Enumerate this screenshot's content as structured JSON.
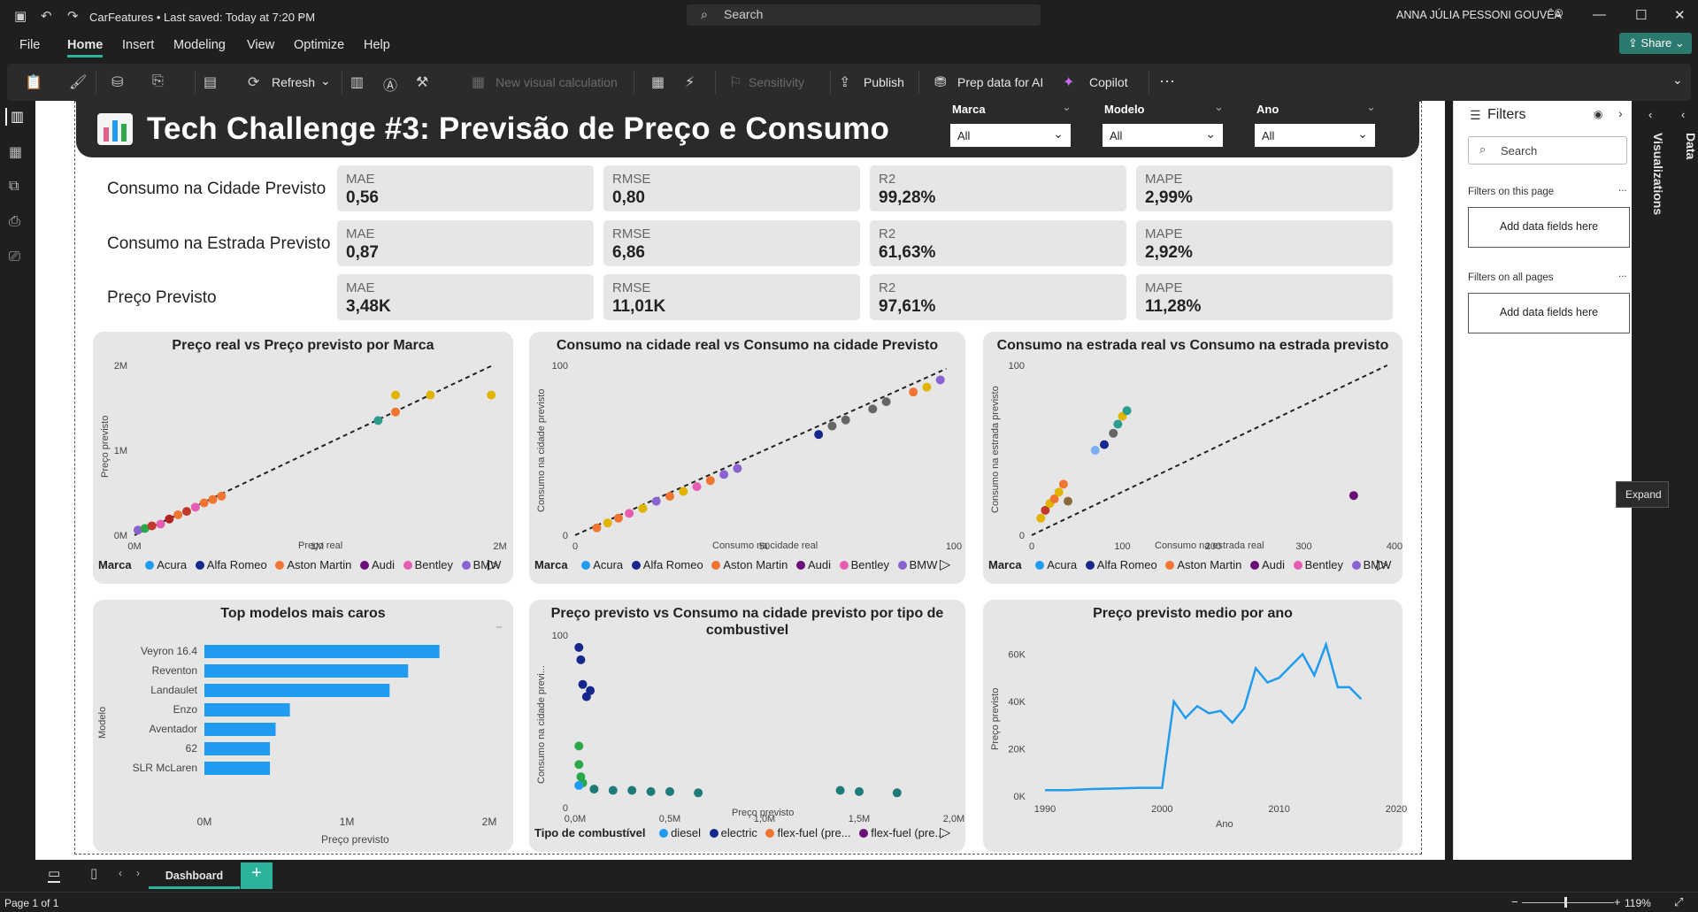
{
  "window": {
    "doc_title": "CarFeatures • Last saved: Today at 7:20 PM",
    "search_placeholder": "Search",
    "user_name": "ANNA JÚLIA PESSONI GOUVÊA"
  },
  "menu": [
    "File",
    "Home",
    "Insert",
    "Modeling",
    "View",
    "Optimize",
    "Help"
  ],
  "share_label": "Share",
  "ribbon": {
    "refresh": "Refresh",
    "new_visual_calc": "New visual calculation",
    "sensitivity": "Sensitivity",
    "publish": "Publish",
    "prep_data": "Prep data for AI",
    "copilot": "Copilot",
    "more": "···"
  },
  "report": {
    "title": "Tech Challenge #3: Previsão de Preço e Consumo",
    "slicers": [
      {
        "label": "Marca",
        "value": "All"
      },
      {
        "label": "Modelo",
        "value": "All"
      },
      {
        "label": "Ano",
        "value": "All"
      }
    ],
    "metric_rows": [
      {
        "label": "Consumo na Cidade Previsto",
        "cards": [
          {
            "k": "MAE",
            "v": "0,56"
          },
          {
            "k": "RMSE",
            "v": "0,80"
          },
          {
            "k": "R2",
            "v": "99,28%"
          },
          {
            "k": "MAPE",
            "v": "2,99%"
          }
        ]
      },
      {
        "label": "Consumo na Estrada Previsto",
        "cards": [
          {
            "k": "MAE",
            "v": "0,87"
          },
          {
            "k": "RMSE",
            "v": "6,86"
          },
          {
            "k": "R2",
            "v": "61,63%"
          },
          {
            "k": "MAPE",
            "v": "2,92%"
          }
        ]
      },
      {
        "label": "Preço Previsto",
        "cards": [
          {
            "k": "MAE",
            "v": "3,48K"
          },
          {
            "k": "RMSE",
            "v": "11,01K"
          },
          {
            "k": "R2",
            "v": "97,61%"
          },
          {
            "k": "MAPE",
            "v": "11,28%"
          }
        ]
      }
    ],
    "brand_legend": {
      "title": "Marca",
      "items": [
        {
          "name": "Acura",
          "color": "#1f9bf0"
        },
        {
          "name": "Alfa Romeo",
          "color": "#15288c"
        },
        {
          "name": "Aston Martin",
          "color": "#f07530"
        },
        {
          "name": "Audi",
          "color": "#6a0f7a"
        },
        {
          "name": "Bentley",
          "color": "#e65cb2"
        },
        {
          "name": "BMW",
          "color": "#8a63d2"
        }
      ]
    },
    "fuel_legend": {
      "title": "Tipo de combustível",
      "items": [
        {
          "name": "diesel",
          "color": "#1f9bf0"
        },
        {
          "name": "electric",
          "color": "#15288c"
        },
        {
          "name": "flex-fuel (pre...",
          "color": "#f07530"
        },
        {
          "name": "flex-fuel (pre...",
          "color": "#6a0f7a"
        }
      ]
    }
  },
  "chart_data": [
    {
      "type": "scatter",
      "title": "Preço real vs Preço previsto por Marca",
      "xlabel": "Preço real",
      "ylabel": "Preço previsto",
      "xticks": [
        "0M",
        "1M",
        "2M"
      ],
      "yticks": [
        "0M",
        "1M",
        "2M"
      ],
      "xlim": [
        0,
        2100000
      ],
      "ylim": [
        0,
        2000000
      ],
      "trendline": true,
      "points": [
        [
          20000,
          60000,
          "#8a63d2"
        ],
        [
          60000,
          80000,
          "#2aa84a"
        ],
        [
          100000,
          110000,
          "#c0392b"
        ],
        [
          150000,
          130000,
          "#e65cb2"
        ],
        [
          200000,
          190000,
          "#b22222"
        ],
        [
          250000,
          240000,
          "#f07530"
        ],
        [
          300000,
          280000,
          "#c0392b"
        ],
        [
          350000,
          330000,
          "#e65cb2"
        ],
        [
          400000,
          380000,
          "#f07530"
        ],
        [
          450000,
          420000,
          "#f07530"
        ],
        [
          500000,
          460000,
          "#f07530"
        ],
        [
          1400000,
          1350000,
          "#2a9d8f"
        ],
        [
          1500000,
          1450000,
          "#f07530"
        ],
        [
          1500000,
          1650000,
          "#e0b400"
        ],
        [
          1700000,
          1650000,
          "#e0b400"
        ],
        [
          2050000,
          1650000,
          "#e0b400"
        ]
      ]
    },
    {
      "type": "scatter",
      "title": "Consumo na cidade real vs Consumo na cidade Previsto",
      "xlabel": "Consumo na cidade real",
      "ylabel": "Consumo na cidade previsto",
      "xticks": [
        "0",
        "50",
        "100"
      ],
      "yticks": [
        "0",
        "100"
      ],
      "xlim": [
        0,
        140
      ],
      "ylim": [
        0,
        140
      ],
      "trendline": true,
      "points": [
        [
          8,
          6,
          "#f07530"
        ],
        [
          12,
          10,
          "#e0b400"
        ],
        [
          16,
          14,
          "#f07530"
        ],
        [
          20,
          18,
          "#e65cb2"
        ],
        [
          25,
          22,
          "#e0b400"
        ],
        [
          30,
          28,
          "#8a63d2"
        ],
        [
          35,
          32,
          "#f07530"
        ],
        [
          40,
          36,
          "#e0b400"
        ],
        [
          45,
          40,
          "#e65cb2"
        ],
        [
          50,
          45,
          "#f07530"
        ],
        [
          55,
          50,
          "#8a63d2"
        ],
        [
          60,
          55,
          "#8a63d2"
        ],
        [
          90,
          83,
          "#15288c"
        ],
        [
          95,
          90,
          "#666666"
        ],
        [
          100,
          95,
          "#666666"
        ],
        [
          110,
          104,
          "#666666"
        ],
        [
          115,
          110,
          "#666666"
        ],
        [
          125,
          118,
          "#f07530"
        ],
        [
          130,
          122,
          "#e0b400"
        ],
        [
          135,
          128,
          "#8a63d2"
        ]
      ]
    },
    {
      "type": "scatter",
      "title": "Consumo na estrada real vs Consumo na estrada previsto",
      "xlabel": "Consumo na estrada real",
      "ylabel": "Consumo na estrada previsto",
      "xticks": [
        "0",
        "100",
        "200",
        "300",
        "400"
      ],
      "yticks": [
        "0",
        "100"
      ],
      "xlim": [
        0,
        400
      ],
      "ylim": [
        0,
        150
      ],
      "trendline": true,
      "points": [
        [
          10,
          15,
          "#e0b400"
        ],
        [
          15,
          22,
          "#c0392b"
        ],
        [
          20,
          28,
          "#e0b400"
        ],
        [
          25,
          32,
          "#f07530"
        ],
        [
          30,
          38,
          "#e0b400"
        ],
        [
          35,
          45,
          "#f07530"
        ],
        [
          40,
          30,
          "#8a6a3a"
        ],
        [
          70,
          75,
          "#7aaef0"
        ],
        [
          80,
          80,
          "#15288c"
        ],
        [
          90,
          90,
          "#666666"
        ],
        [
          95,
          98,
          "#2a9d8f"
        ],
        [
          100,
          105,
          "#e0b400"
        ],
        [
          105,
          110,
          "#2a9d8f"
        ],
        [
          355,
          35,
          "#6a0f7a"
        ]
      ]
    },
    {
      "type": "bar",
      "orientation": "horizontal",
      "title": "Top modelos mais caros",
      "xlabel": "Preço previsto",
      "ylabel": "Modelo",
      "categories": [
        "Veyron 16.4",
        "Reventon",
        "Landaulet",
        "Enzo",
        "Aventador",
        "62",
        "SLR McLaren"
      ],
      "values": [
        1650000,
        1430000,
        1300000,
        600000,
        500000,
        460000,
        460000
      ],
      "xticks": [
        "0M",
        "1M",
        "2M"
      ],
      "xlim": [
        0,
        2000000
      ],
      "color": "#1f9bf0"
    },
    {
      "type": "scatter",
      "title": "Preço previsto vs Consumo na cidade previsto por tipo de combustivel",
      "xlabel": "Preço previsto",
      "ylabel": "Consumo na cidade previ...",
      "xticks": [
        "0,0M",
        "0,5M",
        "1,0M",
        "1,5M",
        "2,0M"
      ],
      "yticks": [
        "0",
        "100"
      ],
      "xlim": [
        0,
        2000000
      ],
      "ylim": [
        0,
        140
      ],
      "points": [
        [
          20000,
          130,
          "#15288c"
        ],
        [
          30000,
          120,
          "#15288c"
        ],
        [
          40000,
          100,
          "#15288c"
        ],
        [
          60000,
          90,
          "#15288c"
        ],
        [
          80000,
          95,
          "#15288c"
        ],
        [
          20000,
          50,
          "#2aa84a"
        ],
        [
          20000,
          35,
          "#2aa84a"
        ],
        [
          30000,
          25,
          "#2aa84a"
        ],
        [
          40000,
          20,
          "#2aa84a"
        ],
        [
          100000,
          15,
          "#1f7a7a"
        ],
        [
          200000,
          14,
          "#1f7a7a"
        ],
        [
          300000,
          14,
          "#1f7a7a"
        ],
        [
          400000,
          13,
          "#1f7a7a"
        ],
        [
          500000,
          13,
          "#1f7a7a"
        ],
        [
          650000,
          12,
          "#1f7a7a"
        ],
        [
          1400000,
          14,
          "#1f7a7a"
        ],
        [
          1500000,
          13,
          "#1f7a7a"
        ],
        [
          1700000,
          12,
          "#1f7a7a"
        ],
        [
          20000,
          18,
          "#1f9bf0"
        ]
      ]
    },
    {
      "type": "line",
      "title": "Preço previsto medio por ano",
      "xlabel": "Ano",
      "ylabel": "Preço previsto",
      "xticks": [
        "1990",
        "2000",
        "2010",
        "2020"
      ],
      "yticks": [
        "0K",
        "20K",
        "40K",
        "60K"
      ],
      "xlim": [
        1990,
        2020
      ],
      "ylim": [
        0,
        65000
      ],
      "x": [
        1990,
        1992,
        1994,
        1996,
        1998,
        2000,
        2001,
        2002,
        2003,
        2004,
        2005,
        2006,
        2007,
        2008,
        2009,
        2010,
        2011,
        2012,
        2013,
        2014,
        2015,
        2016,
        2017
      ],
      "y": [
        2500,
        2500,
        3000,
        3200,
        3500,
        3500,
        40000,
        33000,
        38000,
        35000,
        36000,
        31000,
        37000,
        54000,
        48000,
        50000,
        55000,
        60000,
        51000,
        64000,
        46000,
        46000,
        41000
      ],
      "color": "#1f9bf0"
    }
  ],
  "filters_pane": {
    "title": "Filters",
    "search": "Search",
    "on_this_page": "Filters on this page",
    "on_all_pages": "Filters on all pages",
    "add_fields": "Add data fields here",
    "more": "..."
  },
  "right_rail": {
    "visualizations": "Visualizations",
    "data": "Data",
    "expand_tooltip": "Expand"
  },
  "tabs": {
    "active": "Dashboard",
    "add": "+"
  },
  "status": {
    "page": "Page 1 of 1",
    "zoom": "119%"
  }
}
